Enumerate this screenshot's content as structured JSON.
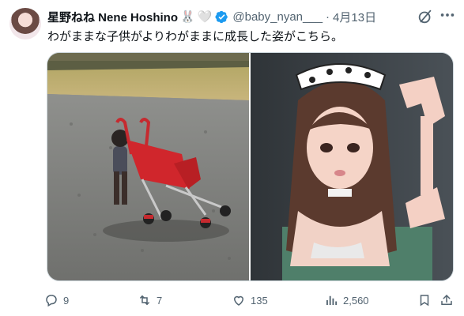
{
  "author": {
    "display_name": "星野ねね Nene Hoshino",
    "emoji_1": "🐰",
    "emoji_2": "🤍",
    "handle": "@baby_nyan___",
    "separator": "·",
    "date": "4月13日"
  },
  "tweet": {
    "text": "わがままな子供がよりわがままに成長した姿がこちら。"
  },
  "actions": {
    "replies": "9",
    "retweets": "7",
    "likes": "135",
    "views": "2,560"
  },
  "colors": {
    "text_primary": "#0f1419",
    "text_secondary": "#536471",
    "verified_blue": "#1d9bf0",
    "border": "#cfd9de"
  }
}
